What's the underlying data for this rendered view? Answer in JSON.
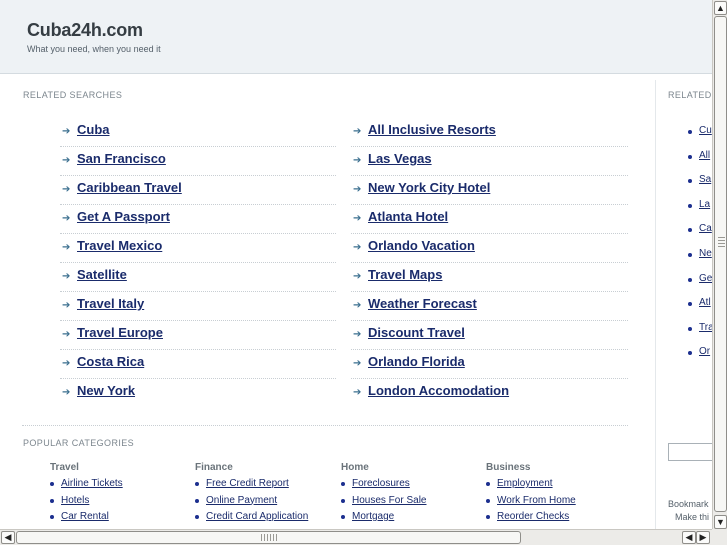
{
  "header": {
    "title": "Cuba24h.com",
    "tagline": "What you need, when you need it"
  },
  "related": {
    "label": "RELATED SEARCHES",
    "left": [
      "Cuba",
      "San Francisco",
      "Caribbean Travel",
      "Get A Passport",
      "Travel Mexico",
      "Satellite",
      "Travel Italy",
      "Travel Europe",
      "Costa Rica",
      "New York"
    ],
    "right": [
      "All Inclusive Resorts",
      "Las Vegas",
      "New York City Hotel",
      "Atlanta Hotel",
      "Orlando Vacation",
      "Travel Maps",
      "Weather Forecast",
      "Discount Travel",
      "Orlando Florida",
      "London Accomodation"
    ]
  },
  "popular": {
    "label": "POPULAR CATEGORIES",
    "categories": [
      {
        "title": "Travel",
        "links": [
          "Airline Tickets",
          "Hotels",
          "Car Rental"
        ]
      },
      {
        "title": "Finance",
        "links": [
          "Free Credit Report",
          "Online Payment",
          "Credit Card Application"
        ]
      },
      {
        "title": "Home",
        "links": [
          "Foreclosures",
          "Houses For Sale",
          "Mortgage"
        ]
      },
      {
        "title": "Business",
        "links": [
          "Employment",
          "Work From Home",
          "Reorder Checks"
        ]
      }
    ]
  },
  "sidebar": {
    "label": "RELATED",
    "links": [
      "Cu",
      "All",
      "Sa",
      "La",
      "Ca",
      "Ne",
      "Ge",
      "Atl",
      "Tra",
      "Or"
    ],
    "bookmark": "Bookmark",
    "make_this": "Make thi"
  },
  "icons": {
    "arrow": "right-arrow-icon",
    "scroll_up": "scroll-up-icon",
    "scroll_down": "scroll-down-icon",
    "scroll_left": "scroll-left-icon",
    "scroll_right": "scroll-right-icon"
  },
  "colors": {
    "header_bg": "#eef2f5",
    "link": "#1a2b6b",
    "arrow": "#3b6f8f"
  }
}
